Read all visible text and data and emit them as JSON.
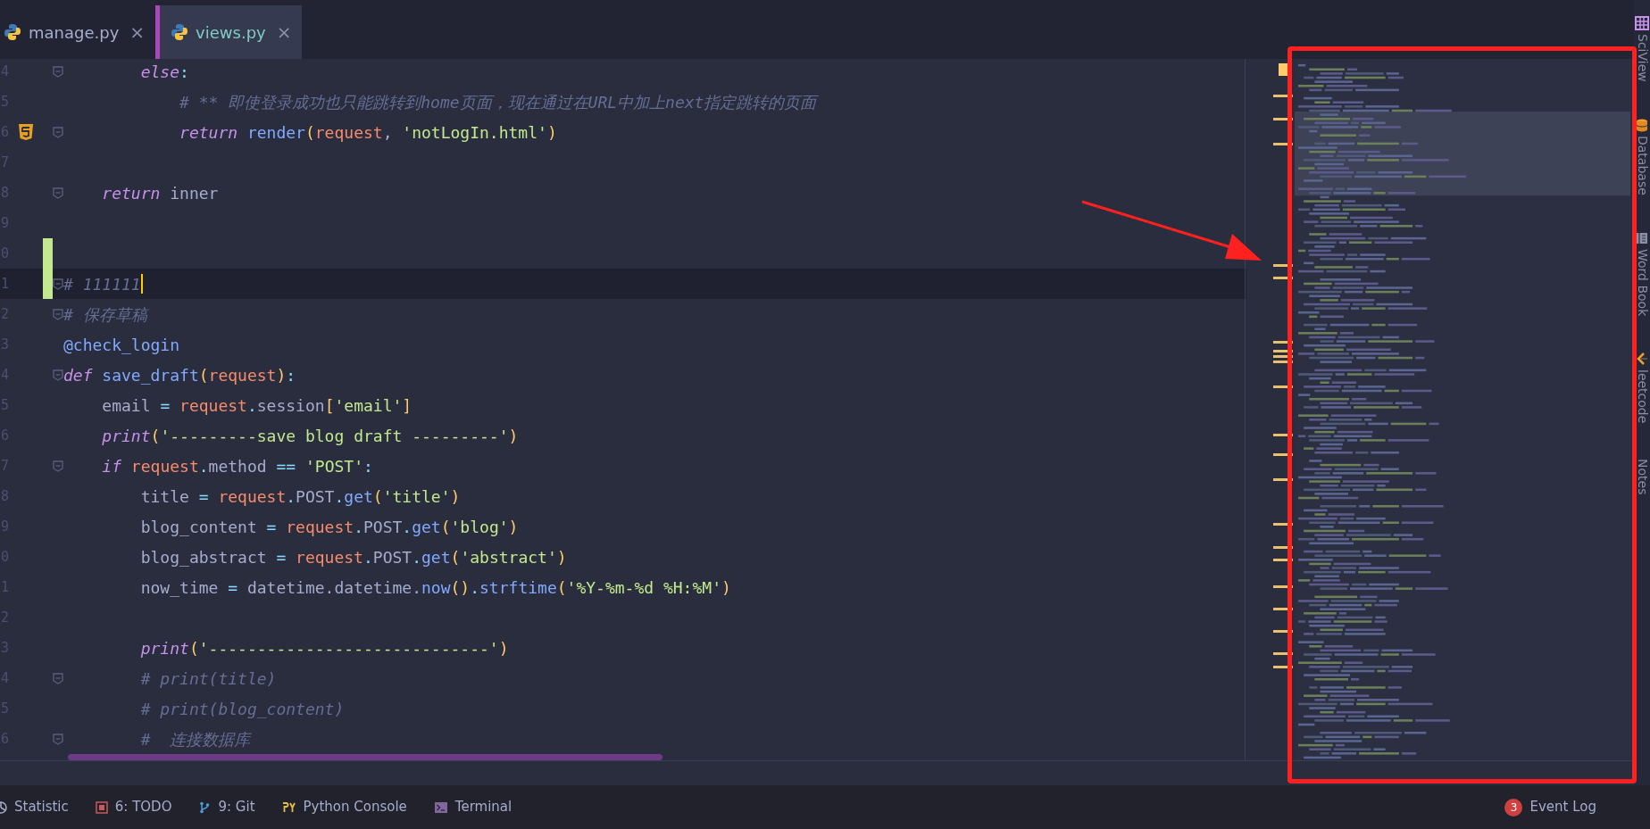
{
  "tabs": [
    {
      "label": "manage.py",
      "selected": false,
      "close": "×"
    },
    {
      "label": "views.py",
      "selected": true,
      "close": "×"
    }
  ],
  "editor": {
    "lines": [
      {
        "number": "4",
        "fold": true,
        "modified": false,
        "current": false,
        "html_icon": false,
        "tokens": [
          {
            "kind": "kw",
            "text": "        else"
          },
          {
            "kind": "punct",
            "text": ":"
          }
        ]
      },
      {
        "number": "5",
        "fold": false,
        "modified": false,
        "current": false,
        "html_icon": false,
        "tokens": [
          {
            "kind": "comment",
            "text": "            # ** 即使登录成功也只能跳转到home页面，现在通过在URL中加上next指定跳转的页面"
          }
        ]
      },
      {
        "number": "6",
        "fold": true,
        "modified": false,
        "current": false,
        "html_icon": true,
        "tokens": [
          {
            "kind": "kw",
            "text": "            return"
          },
          {
            "kind": "fn",
            "text": " render"
          },
          {
            "kind": "paren",
            "text": "("
          },
          {
            "kind": "param",
            "text": "request"
          },
          {
            "kind": "plain",
            "text": ", "
          },
          {
            "kind": "str",
            "text": "'notLogIn.html'"
          },
          {
            "kind": "paren",
            "text": ")"
          }
        ]
      },
      {
        "number": "7",
        "fold": false,
        "modified": false,
        "current": false,
        "html_icon": false
      },
      {
        "number": "8",
        "fold": true,
        "modified": false,
        "current": false,
        "html_icon": false,
        "tokens": [
          {
            "kind": "kw",
            "text": "    return"
          },
          {
            "kind": "plain",
            "text": " inner"
          }
        ]
      },
      {
        "number": "9",
        "fold": false,
        "modified": false,
        "current": false,
        "html_icon": false
      },
      {
        "number": "0",
        "fold": false,
        "modified": true,
        "current": false,
        "html_icon": false
      },
      {
        "number": "1",
        "fold": true,
        "modified": true,
        "current": true,
        "html_icon": false,
        "tokens": [
          {
            "kind": "comment",
            "text": "# 111111"
          }
        ]
      },
      {
        "number": "2",
        "fold": true,
        "modified": false,
        "current": false,
        "html_icon": false,
        "tokens": [
          {
            "kind": "comment",
            "text": "# 保存草稿"
          }
        ]
      },
      {
        "number": "3",
        "fold": false,
        "modified": false,
        "current": false,
        "html_icon": false,
        "tokens": [
          {
            "kind": "deco",
            "text": "@check_login"
          }
        ]
      },
      {
        "number": "4",
        "fold": true,
        "modified": false,
        "current": false,
        "html_icon": false,
        "tokens": [
          {
            "kind": "kw",
            "text": "def"
          },
          {
            "kind": "fn",
            "text": " save_draft"
          },
          {
            "kind": "paren",
            "text": "("
          },
          {
            "kind": "param",
            "text": "request"
          },
          {
            "kind": "paren",
            "text": ")"
          },
          {
            "kind": "punct",
            "text": ":"
          }
        ]
      },
      {
        "number": "5",
        "fold": false,
        "modified": false,
        "current": false,
        "html_icon": false,
        "tokens": [
          {
            "kind": "plain",
            "text": "    email "
          },
          {
            "kind": "punct",
            "text": "="
          },
          {
            "kind": "param",
            "text": " request"
          },
          {
            "kind": "punct",
            "text": "."
          },
          {
            "kind": "plain",
            "text": "session"
          },
          {
            "kind": "paren",
            "text": "["
          },
          {
            "kind": "str",
            "text": "'email'"
          },
          {
            "kind": "paren",
            "text": "]"
          }
        ]
      },
      {
        "number": "6",
        "fold": false,
        "modified": false,
        "current": false,
        "html_icon": false,
        "tokens": [
          {
            "kind": "kw",
            "text": "    print"
          },
          {
            "kind": "paren",
            "text": "("
          },
          {
            "kind": "str",
            "text": "'---------save blog draft ---------'"
          },
          {
            "kind": "paren",
            "text": ")"
          }
        ]
      },
      {
        "number": "7",
        "fold": true,
        "modified": false,
        "current": false,
        "html_icon": false,
        "tokens": [
          {
            "kind": "kw",
            "text": "    if"
          },
          {
            "kind": "param",
            "text": " request"
          },
          {
            "kind": "punct",
            "text": "."
          },
          {
            "kind": "plain",
            "text": "method "
          },
          {
            "kind": "punct",
            "text": "=="
          },
          {
            "kind": "str",
            "text": " 'POST'"
          },
          {
            "kind": "punct",
            "text": ":"
          }
        ]
      },
      {
        "number": "8",
        "fold": false,
        "modified": false,
        "current": false,
        "html_icon": false,
        "tokens": [
          {
            "kind": "plain",
            "text": "        title "
          },
          {
            "kind": "punct",
            "text": "="
          },
          {
            "kind": "param",
            "text": " request"
          },
          {
            "kind": "punct",
            "text": "."
          },
          {
            "kind": "plain",
            "text": "POST"
          },
          {
            "kind": "punct",
            "text": "."
          },
          {
            "kind": "fn",
            "text": "get"
          },
          {
            "kind": "paren",
            "text": "("
          },
          {
            "kind": "str",
            "text": "'title'"
          },
          {
            "kind": "paren",
            "text": ")"
          }
        ]
      },
      {
        "number": "9",
        "fold": false,
        "modified": false,
        "current": false,
        "html_icon": false,
        "tokens": [
          {
            "kind": "plain",
            "text": "        blog_content "
          },
          {
            "kind": "punct",
            "text": "="
          },
          {
            "kind": "param",
            "text": " request"
          },
          {
            "kind": "punct",
            "text": "."
          },
          {
            "kind": "plain",
            "text": "POST"
          },
          {
            "kind": "punct",
            "text": "."
          },
          {
            "kind": "fn",
            "text": "get"
          },
          {
            "kind": "paren",
            "text": "("
          },
          {
            "kind": "str",
            "text": "'blog'"
          },
          {
            "kind": "paren",
            "text": ")"
          }
        ]
      },
      {
        "number": "0",
        "fold": false,
        "modified": false,
        "current": false,
        "html_icon": false,
        "tokens": [
          {
            "kind": "plain",
            "text": "        blog_abstract "
          },
          {
            "kind": "punct",
            "text": "="
          },
          {
            "kind": "param",
            "text": " request"
          },
          {
            "kind": "punct",
            "text": "."
          },
          {
            "kind": "plain",
            "text": "POST"
          },
          {
            "kind": "punct",
            "text": "."
          },
          {
            "kind": "fn",
            "text": "get"
          },
          {
            "kind": "paren",
            "text": "("
          },
          {
            "kind": "str",
            "text": "'abstract'"
          },
          {
            "kind": "paren",
            "text": ")"
          }
        ]
      },
      {
        "number": "1",
        "fold": false,
        "modified": false,
        "current": false,
        "html_icon": false,
        "tokens": [
          {
            "kind": "plain",
            "text": "        now_time "
          },
          {
            "kind": "punct",
            "text": "="
          },
          {
            "kind": "plain",
            "text": " datetime.datetime."
          },
          {
            "kind": "fn",
            "text": "now"
          },
          {
            "kind": "paren",
            "text": "()"
          },
          {
            "kind": "punct",
            "text": "."
          },
          {
            "kind": "fn",
            "text": "strftime"
          },
          {
            "kind": "paren",
            "text": "("
          },
          {
            "kind": "str",
            "text": "'%Y-%m-%d %H:%M'"
          },
          {
            "kind": "paren",
            "text": ")"
          }
        ]
      },
      {
        "number": "2",
        "fold": false,
        "modified": false,
        "current": false,
        "html_icon": false
      },
      {
        "number": "3",
        "fold": false,
        "modified": false,
        "current": false,
        "html_icon": false,
        "tokens": [
          {
            "kind": "kw",
            "text": "        print"
          },
          {
            "kind": "paren",
            "text": "("
          },
          {
            "kind": "str",
            "text": "'-----------------------------'"
          },
          {
            "kind": "paren",
            "text": ")"
          }
        ]
      },
      {
        "number": "4",
        "fold": true,
        "modified": false,
        "current": false,
        "html_icon": false,
        "tokens": [
          {
            "kind": "comment",
            "text": "        # print(title)"
          }
        ]
      },
      {
        "number": "5",
        "fold": false,
        "modified": false,
        "current": false,
        "html_icon": false,
        "tokens": [
          {
            "kind": "comment",
            "text": "        # print(blog_content)"
          }
        ]
      },
      {
        "number": "6",
        "fold": true,
        "modified": false,
        "current": false,
        "html_icon": false,
        "tokens": [
          {
            "kind": "comment",
            "text": "        #  连接数据库"
          }
        ]
      }
    ]
  },
  "tool_windows_right": [
    {
      "kind": "grid",
      "label": "SciView"
    },
    {
      "kind": "database",
      "label": "Database"
    },
    {
      "kind": "book",
      "label": "Word Book"
    },
    {
      "kind": "leetcode",
      "label": "leetcode"
    },
    {
      "kind": "none",
      "label": "Notes"
    }
  ],
  "bottom_tools": [
    {
      "kind": "statistic",
      "label": "Statistic"
    },
    {
      "kind": "todo",
      "label": "6: TODO"
    },
    {
      "kind": "git",
      "label": "9: Git"
    },
    {
      "kind": "python",
      "label": "Python Console"
    },
    {
      "kind": "terminal",
      "label": "Terminal"
    }
  ],
  "event_log": {
    "label": "Event Log",
    "badge": "3"
  }
}
